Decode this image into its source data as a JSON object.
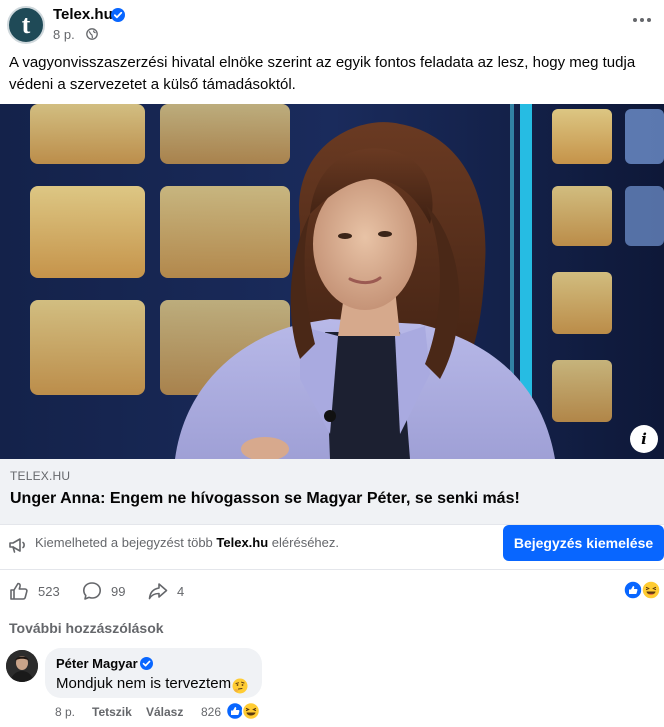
{
  "post": {
    "page_name": "Telex.hu",
    "logo_letter": "t",
    "time": "8 p.",
    "text": "A vagyonvisszaszerzési hivatal elnöke szerint az egyik fontos feladata az lesz, hogy meg tudja védeni a szervezetet a külső támadásoktól."
  },
  "link_preview": {
    "info_label": "i",
    "domain": "TELEX.HU",
    "title": "Unger Anna: Engem ne hívogasson se Magyar Péter, se senki más!"
  },
  "promo": {
    "text_before": "Kiemelheted a bejegyzést több ",
    "text_page": "Telex.hu",
    "text_after": " eléréséhez.",
    "button_label": "Bejegyzés kiemelése"
  },
  "actions": {
    "likes": "523",
    "comments": "99",
    "shares": "4"
  },
  "comments": {
    "more_label": "További hozzászólások",
    "items": [
      {
        "author": "Péter Magyar",
        "text": "Mondjuk nem is terveztem",
        "time": "8 p.",
        "like_label": "Tetszik",
        "reply_label": "Válasz",
        "reaction_count": "826"
      }
    ]
  },
  "colors": {
    "accent": "#0866ff",
    "secondary_text": "#65676b",
    "link_bg": "#f0f2f5"
  },
  "icons": [
    "verified-badge-icon",
    "globe-icon",
    "more-dots-icon",
    "megaphone-icon",
    "like-icon",
    "comment-icon",
    "share-icon",
    "like-reaction-icon",
    "haha-reaction-icon",
    "thinking-emoji-icon"
  ]
}
